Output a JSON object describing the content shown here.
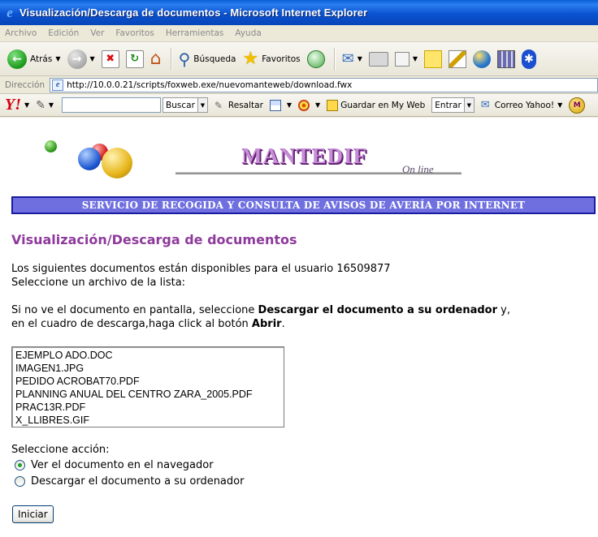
{
  "window": {
    "title": "Visualización/Descarga de documentos - Microsoft Internet Explorer"
  },
  "menubar": {
    "items": [
      "Archivo",
      "Edición",
      "Ver",
      "Favoritos",
      "Herramientas",
      "Ayuda"
    ]
  },
  "toolbar": {
    "back_label": "Atrás",
    "search_label": "Búsqueda",
    "favorites_label": "Favoritos"
  },
  "addressbar": {
    "label": "Dirección",
    "url": "http://10.0.0.21/scripts/foxweb.exe/nuevomanteweb/download.fwx"
  },
  "yahoobar": {
    "logo": "Y!",
    "search_value": "",
    "search_button": "Buscar",
    "highlight_label": "Resaltar",
    "save_label": "Guardar en My Web",
    "login_label": "Entrar",
    "mail_label": "Correo Yahoo!",
    "badge": "M"
  },
  "page": {
    "logo_text": "MANTEDIF",
    "logo_sub": "On line",
    "banner": "SERVICIO DE RECOGIDA Y CONSULTA DE AVISOS DE AVERÍA POR INTERNET",
    "title": "Visualización/Descarga de documentos",
    "intro_line1": "Los siguientes documentos están disponibles para el usuario 16509877",
    "intro_line2": "Seleccione un archivo de la lista:",
    "help_line1_a": "Si no ve el documento en pantalla, seleccione ",
    "help_line1_b": "Descargar el documento a su ordenador",
    "help_line1_c": " y,",
    "help_line2_a": "en el cuadro de descarga,haga click al botón ",
    "help_line2_b": "Abrir",
    "help_line2_c": ".",
    "files": [
      "EJEMPLO ADO.DOC",
      "IMAGEN1.JPG",
      "PEDIDO ACROBAT70.PDF",
      "PLANNING ANUAL DEL CENTRO ZARA_2005.PDF",
      "PRAC13R.PDF",
      "X_LLIBRES.GIF"
    ],
    "action_label": "Seleccione acción:",
    "option_view": "Ver el documento en el navegador",
    "option_download": "Descargar el documento a su ordenador",
    "selected_option": "view",
    "start_button": "Iniciar"
  },
  "colors": {
    "title_purple": "#8e3a9c",
    "banner_bg": "#6f6fe0",
    "banner_border": "#1a1aa0",
    "titlebar_blue": "#0a53d1"
  }
}
